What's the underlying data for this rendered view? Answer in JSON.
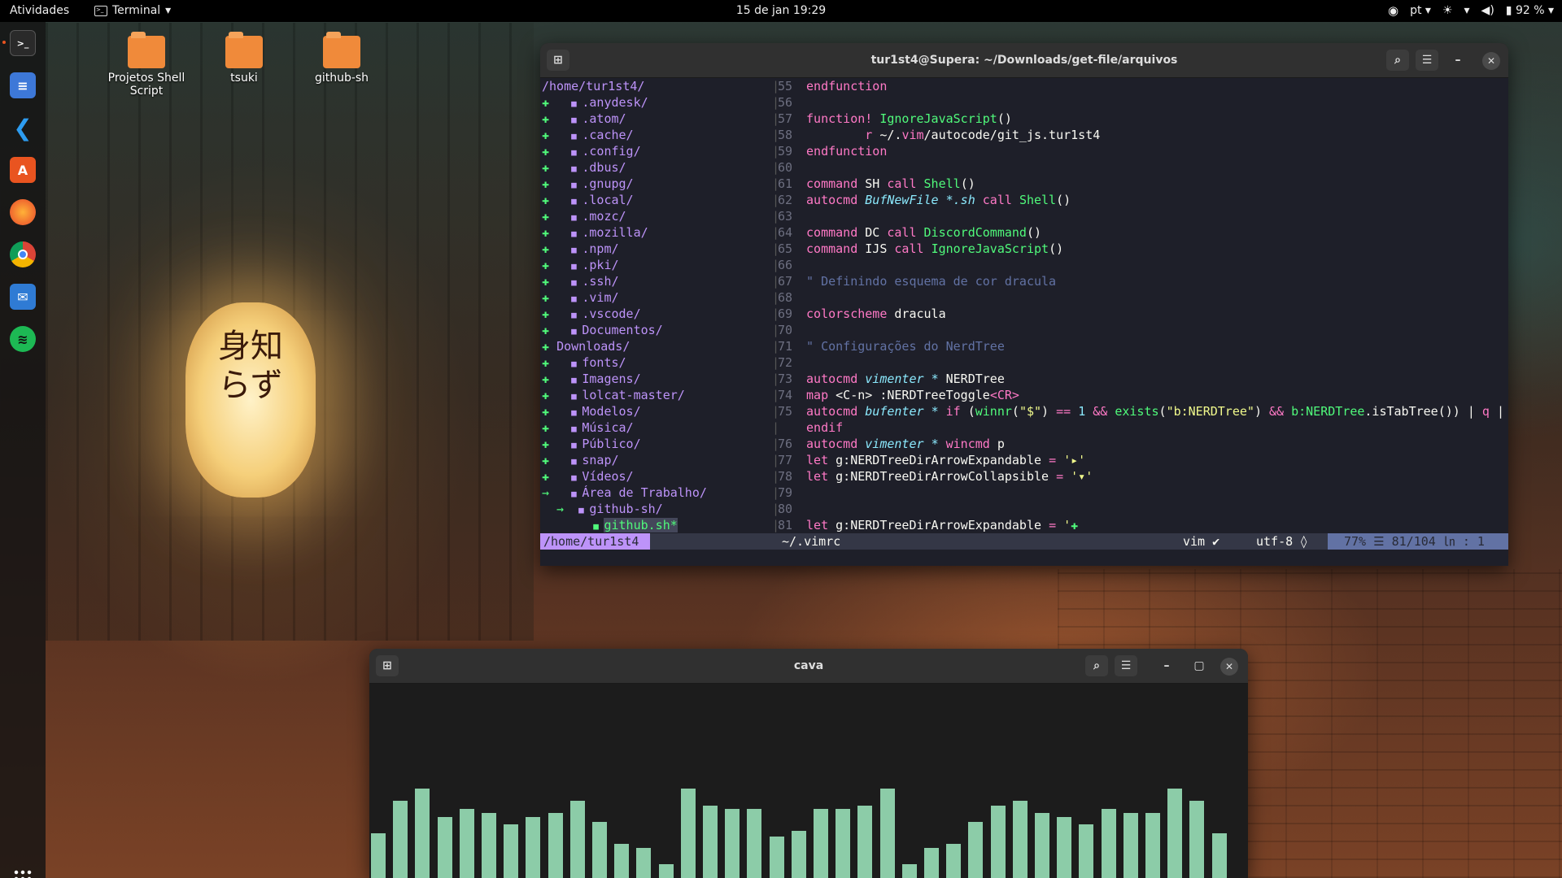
{
  "topbar": {
    "activities": "Atividades",
    "app_name": "Terminal",
    "clock": "15 de jan  19:29",
    "lang": "pt",
    "battery": "92 %"
  },
  "dock": {
    "items": [
      "terminal",
      "text-editor",
      "vscode",
      "app-center",
      "firefox",
      "chrome",
      "thunderbird",
      "spotify"
    ]
  },
  "desktop": {
    "icons": [
      "Projetos Shell Script",
      "tsuki",
      "github-sh"
    ]
  },
  "terminal": {
    "title": "tur1st4@Supera: ~/Downloads/get-file/arquivos",
    "tree_root": "/home/tur1st4/",
    "tree": [
      {
        "m": "+",
        "indent": "  ",
        "name": ".anydesk/"
      },
      {
        "m": "+",
        "indent": "  ",
        "name": ".atom/"
      },
      {
        "m": "+",
        "indent": "  ",
        "name": ".cache/"
      },
      {
        "m": "+",
        "indent": "  ",
        "name": ".config/"
      },
      {
        "m": "+",
        "indent": "  ",
        "name": ".dbus/"
      },
      {
        "m": "+",
        "indent": "  ",
        "name": ".gnupg/"
      },
      {
        "m": "+",
        "indent": "  ",
        "name": ".local/"
      },
      {
        "m": "+",
        "indent": "  ",
        "name": ".mozc/"
      },
      {
        "m": "+",
        "indent": "  ",
        "name": ".mozilla/"
      },
      {
        "m": "+",
        "indent": "  ",
        "name": ".npm/"
      },
      {
        "m": "+",
        "indent": "  ",
        "name": ".pki/"
      },
      {
        "m": "+",
        "indent": "  ",
        "name": ".ssh/"
      },
      {
        "m": "+",
        "indent": "  ",
        "name": ".vim/"
      },
      {
        "m": "+",
        "indent": "  ",
        "name": ".vscode/"
      },
      {
        "m": "+",
        "indent": "  ",
        "name": "Documentos/"
      },
      {
        "m": "+",
        "indent": "",
        "name": "Downloads/",
        "nofolder": true
      },
      {
        "m": "+",
        "indent": "  ",
        "name": "fonts/"
      },
      {
        "m": "+",
        "indent": "  ",
        "name": "Imagens/"
      },
      {
        "m": "+",
        "indent": "  ",
        "name": "lolcat-master/"
      },
      {
        "m": "+",
        "indent": "  ",
        "name": "Modelos/"
      },
      {
        "m": "+",
        "indent": "  ",
        "name": "Música/"
      },
      {
        "m": "+",
        "indent": "  ",
        "name": "Público/"
      },
      {
        "m": "+",
        "indent": "  ",
        "name": "snap/"
      },
      {
        "m": "+",
        "indent": "  ",
        "name": "Vídeos/"
      },
      {
        "m": "→",
        "indent": "  ",
        "name": "Área de Trabalho/"
      },
      {
        "m": "  →",
        "indent": " ",
        "name": "github-sh/"
      },
      {
        "m": "",
        "indent": "      ",
        "name": "github.sh*",
        "file": true
      }
    ],
    "code": [
      {
        "n": "55",
        "t": [
          [
            "kw",
            "endfunction"
          ]
        ]
      },
      {
        "n": "56",
        "t": []
      },
      {
        "n": "57",
        "t": [
          [
            "kw",
            "function! "
          ],
          [
            "fn",
            "IgnoreJavaScript"
          ],
          [
            "pl",
            "()"
          ]
        ]
      },
      {
        "n": "58",
        "t": [
          [
            "pl",
            "        "
          ],
          [
            "kw",
            "r"
          ],
          [
            "pl",
            " ~/."
          ],
          [
            "kw",
            "vim"
          ],
          [
            "pl",
            "/autocode/git_js.tur1st4"
          ]
        ]
      },
      {
        "n": "59",
        "t": [
          [
            "kw",
            "endfunction"
          ]
        ]
      },
      {
        "n": "60",
        "t": []
      },
      {
        "n": "61",
        "t": [
          [
            "kw",
            "command"
          ],
          [
            "pl",
            " SH "
          ],
          [
            "kw",
            "call "
          ],
          [
            "fn",
            "Shell"
          ],
          [
            "pl",
            "()"
          ]
        ]
      },
      {
        "n": "62",
        "t": [
          [
            "kw",
            "autocmd "
          ],
          [
            "it",
            "BufNewFile"
          ],
          [
            "pl",
            " "
          ],
          [
            "it",
            "*.sh"
          ],
          [
            "pl",
            " "
          ],
          [
            "kw",
            "call "
          ],
          [
            "fn",
            "Shell"
          ],
          [
            "pl",
            "()"
          ]
        ]
      },
      {
        "n": "63",
        "t": []
      },
      {
        "n": "64",
        "t": [
          [
            "kw",
            "command"
          ],
          [
            "pl",
            " DC "
          ],
          [
            "kw",
            "call "
          ],
          [
            "fn",
            "DiscordCommand"
          ],
          [
            "pl",
            "()"
          ]
        ]
      },
      {
        "n": "65",
        "t": [
          [
            "kw",
            "command"
          ],
          [
            "pl",
            " IJS "
          ],
          [
            "kw",
            "call "
          ],
          [
            "fn",
            "IgnoreJavaScript"
          ],
          [
            "pl",
            "()"
          ]
        ]
      },
      {
        "n": "66",
        "t": []
      },
      {
        "n": "67",
        "t": [
          [
            "cmt",
            "\" Definindo esquema de cor dracula"
          ]
        ]
      },
      {
        "n": "68",
        "t": []
      },
      {
        "n": "69",
        "t": [
          [
            "kw",
            "colorscheme"
          ],
          [
            "pl",
            " dracula"
          ]
        ]
      },
      {
        "n": "70",
        "t": []
      },
      {
        "n": "71",
        "t": [
          [
            "cmt",
            "\" Configurações do NerdTree"
          ]
        ]
      },
      {
        "n": "72",
        "t": []
      },
      {
        "n": "73",
        "t": [
          [
            "kw",
            "autocmd "
          ],
          [
            "it",
            "vimenter"
          ],
          [
            "pl",
            " "
          ],
          [
            "it",
            "*"
          ],
          [
            "pl",
            " NERDTree"
          ]
        ]
      },
      {
        "n": "74",
        "t": [
          [
            "kw",
            "map"
          ],
          [
            "pl",
            " <C-n> :NERDTreeToggle"
          ],
          [
            "kw",
            "<CR>"
          ]
        ]
      },
      {
        "n": "75",
        "t": [
          [
            "kw",
            "autocmd "
          ],
          [
            "it",
            "bufenter"
          ],
          [
            "pl",
            " "
          ],
          [
            "it",
            "*"
          ],
          [
            "pl",
            " "
          ],
          [
            "kw",
            "if"
          ],
          [
            "pl",
            " ("
          ],
          [
            "fn",
            "winnr"
          ],
          [
            "pl",
            "("
          ],
          [
            "str",
            "\"$\""
          ],
          [
            "pl",
            ") "
          ],
          [
            "kw",
            "=="
          ],
          [
            "pl",
            " "
          ],
          [
            "vr",
            "1"
          ],
          [
            "pl",
            " "
          ],
          [
            "kw",
            "&&"
          ],
          [
            "pl",
            " "
          ],
          [
            "fn",
            "exists"
          ],
          [
            "pl",
            "("
          ],
          [
            "str",
            "\"b:NERDTree\""
          ],
          [
            "pl",
            ") "
          ],
          [
            "kw",
            "&&"
          ],
          [
            "pl",
            " "
          ],
          [
            "fn",
            "b:NERDTree"
          ],
          [
            "pl",
            ".isTabTree()) | "
          ],
          [
            "kw",
            "q"
          ],
          [
            "pl",
            " |"
          ]
        ]
      },
      {
        "n": "",
        "t": [
          [
            "kw",
            "endif"
          ]
        ]
      },
      {
        "n": "76",
        "t": [
          [
            "kw",
            "autocmd "
          ],
          [
            "it",
            "vimenter"
          ],
          [
            "pl",
            " "
          ],
          [
            "it",
            "*"
          ],
          [
            "pl",
            " "
          ],
          [
            "kw",
            "wincmd"
          ],
          [
            "pl",
            " p"
          ]
        ]
      },
      {
        "n": "77",
        "t": [
          [
            "kw",
            "let"
          ],
          [
            "pl",
            " g:NERDTreeDirArrowExpandable "
          ],
          [
            "kw",
            "="
          ],
          [
            "pl",
            " "
          ],
          [
            "str",
            "'▸'"
          ]
        ]
      },
      {
        "n": "78",
        "t": [
          [
            "kw",
            "let"
          ],
          [
            "pl",
            " g:NERDTreeDirArrowCollapsible "
          ],
          [
            "kw",
            "="
          ],
          [
            "pl",
            " "
          ],
          [
            "str",
            "'▾'"
          ]
        ]
      },
      {
        "n": "79",
        "t": []
      },
      {
        "n": "80",
        "t": []
      },
      {
        "n": "81",
        "t": [
          [
            "kw",
            "let"
          ],
          [
            "pl",
            " g:NERDTreeDirArrowExpandable "
          ],
          [
            "kw",
            "="
          ],
          [
            "pl",
            " "
          ],
          [
            "str",
            "'"
          ],
          [
            "plus",
            "✚"
          ]
        ]
      }
    ],
    "status": {
      "left": "/home/tur1st4",
      "file": "~/.vimrc",
      "ft": "vim",
      "enc": "utf-8",
      "pos": "77% ☰  81/104 ㏑ :  1"
    }
  },
  "cava": {
    "title": "cava",
    "levels": [
      0.5,
      0.86,
      1.0,
      0.68,
      0.77,
      0.73,
      0.6,
      0.68,
      0.73,
      0.86,
      0.63,
      0.38,
      0.34,
      0.15,
      1.0,
      0.81,
      0.77,
      0.77,
      0.46,
      0.53,
      0.77,
      0.77,
      0.81,
      1.0,
      0.15,
      0.34,
      0.38,
      0.63,
      0.81,
      0.86,
      0.73,
      0.68,
      0.6,
      0.77,
      0.73,
      0.73,
      1.0,
      0.86,
      0.5
    ]
  },
  "colors": {
    "accent": "#bd93f9",
    "green": "#50fa7b",
    "cava_bar": "#8ccca8"
  }
}
